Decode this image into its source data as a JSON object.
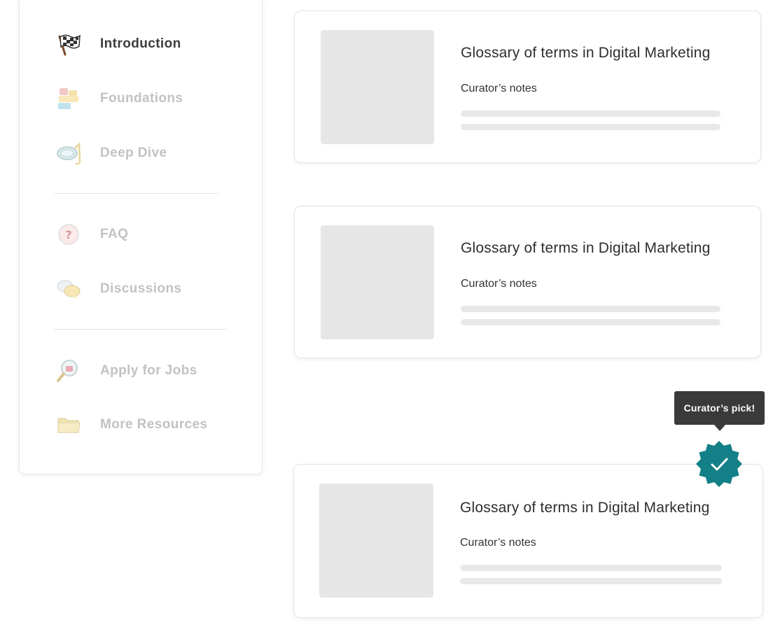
{
  "sidebar": {
    "items": [
      {
        "label": "Introduction",
        "icon": "checkered-flag-icon",
        "active": true
      },
      {
        "label": "Foundations",
        "icon": "building-blocks-icon",
        "active": false
      },
      {
        "label": "Deep Dive",
        "icon": "snorkel-mask-icon",
        "active": false
      },
      {
        "label": "FAQ",
        "icon": "question-badge-icon",
        "active": false
      },
      {
        "label": "Discussions",
        "icon": "chat-bubbles-icon",
        "active": false
      },
      {
        "label": "Apply for Jobs",
        "icon": "magnifier-briefcase-icon",
        "active": false
      },
      {
        "label": "More Resources",
        "icon": "folder-icon",
        "active": false
      }
    ]
  },
  "cards": [
    {
      "title": "Glossary of terms in Digital Marketing",
      "subtitle": "Curator’s notes"
    },
    {
      "title": "Glossary of terms in Digital Marketing",
      "subtitle": "Curator’s notes"
    },
    {
      "title": "Glossary of terms in Digital Marketing",
      "subtitle": "Curator’s notes"
    }
  ],
  "pick": {
    "tooltip": "Curator’s pick!",
    "badge_icon": "check-badge-icon",
    "badge_color": "#137f86"
  },
  "colors": {
    "active_text": "#3c3c3c",
    "inactive_text": "#c2c2c2",
    "placeholder": "#e6e6e6"
  }
}
